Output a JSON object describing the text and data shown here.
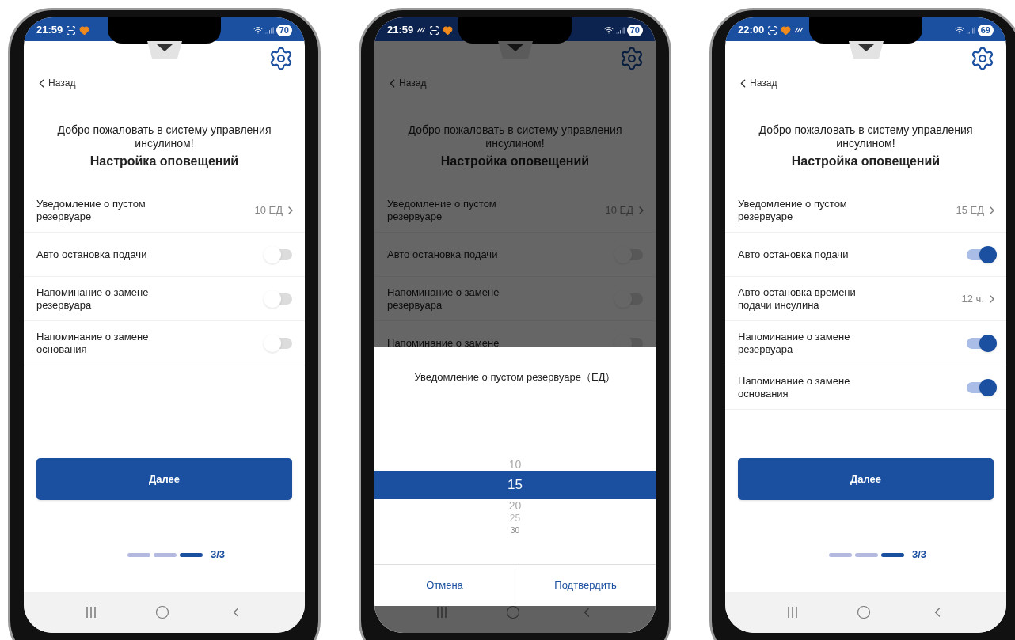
{
  "phones": [
    {
      "status_bar": {
        "time": "21:59",
        "battery": "70",
        "icons": [
          {
            "kind": "scan"
          },
          {
            "kind": "heart"
          }
        ]
      },
      "dimmed": false,
      "back": "Назад",
      "welcome": "Добро пожаловать в систему управления инсулином!",
      "heading": "Настройка оповещений",
      "rows": [
        {
          "kind": "value",
          "label": "Уведомление о пустом резервуаре",
          "value": "10 ЕД"
        },
        {
          "kind": "toggle",
          "label": "Авто остановка подачи",
          "on": false
        },
        {
          "kind": "toggle",
          "label": "Напоминание о замене резервуара",
          "on": false
        },
        {
          "kind": "toggle",
          "label": "Напоминание о замене основания",
          "on": false
        }
      ],
      "button": "Далее",
      "progress": {
        "steps": [
          {
            "selected": false
          },
          {
            "selected": false
          },
          {
            "selected": true
          }
        ],
        "label": "3/3"
      }
    },
    {
      "status_bar": {
        "time": "21:59",
        "battery": "70",
        "icons": [
          {
            "kind": "wave"
          },
          {
            "kind": "scan"
          },
          {
            "kind": "heart"
          }
        ]
      },
      "dimmed": true,
      "back": "Назад",
      "welcome": "Добро пожаловать в систему управления инсулином!",
      "heading": "Настройка оповещений",
      "rows": [
        {
          "kind": "value",
          "label": "Уведомление о пустом резервуаре",
          "value": "10 ЕД"
        },
        {
          "kind": "toggle",
          "label": "Авто остановка подачи",
          "on": false
        },
        {
          "kind": "toggle",
          "label": "Напоминание о замене резервуара",
          "on": false
        },
        {
          "kind": "toggle",
          "label": "Напоминание о замене",
          "on": false
        }
      ],
      "sheet": {
        "title": "Уведомление о пустом резервуаре（ЕД）",
        "options": [
          {
            "label": "10",
            "selected": false
          },
          {
            "label": "15",
            "selected": true
          },
          {
            "label": "20",
            "selected": false
          },
          {
            "label": "25",
            "selected": false
          },
          {
            "label": "30",
            "selected": false
          }
        ],
        "cancel": "Отмена",
        "confirm": "Подтвердить"
      }
    },
    {
      "status_bar": {
        "time": "22:00",
        "battery": "69",
        "icons": [
          {
            "kind": "scan"
          },
          {
            "kind": "heart"
          },
          {
            "kind": "wave"
          }
        ]
      },
      "dimmed": false,
      "back": "Назад",
      "welcome": "Добро пожаловать в систему управления инсулином!",
      "heading": "Настройка оповещений",
      "rows": [
        {
          "kind": "value",
          "label": "Уведомление о пустом резервуаре",
          "value": "15 ЕД"
        },
        {
          "kind": "toggle",
          "label": "Авто остановка подачи",
          "on": true
        },
        {
          "kind": "value",
          "label": "Авто остановка времени подачи инсулина",
          "value": "12 ч."
        },
        {
          "kind": "toggle",
          "label": "Напоминание о замене резервуара",
          "on": true
        },
        {
          "kind": "toggle",
          "label": "Напоминание о замене основания",
          "on": true
        }
      ],
      "button": "Далее",
      "progress": {
        "steps": [
          {
            "selected": false
          },
          {
            "selected": false
          },
          {
            "selected": true
          }
        ],
        "label": "3/3"
      }
    }
  ]
}
